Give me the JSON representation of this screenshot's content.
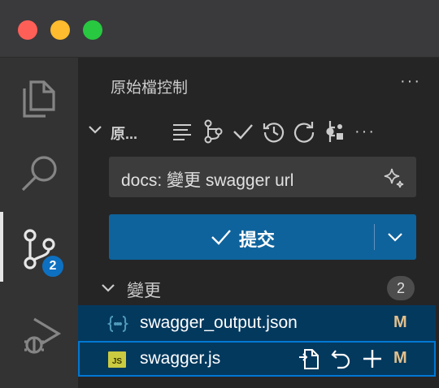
{
  "window": {
    "traffic_lights": [
      "close",
      "minimize",
      "zoom"
    ]
  },
  "activity_bar": {
    "items": [
      {
        "icon": "explorer-icon"
      },
      {
        "icon": "search-icon"
      },
      {
        "icon": "source-control-icon",
        "badge": "2",
        "active": true
      },
      {
        "icon": "run-debug-icon"
      }
    ]
  },
  "panel": {
    "title": "原始檔控制",
    "more": "···"
  },
  "repo": {
    "name": "原...",
    "actions": [
      "view-as-tree-icon",
      "branch-icon",
      "commit-check-icon",
      "history-icon",
      "refresh-icon",
      "graph-icon",
      "more-icon"
    ],
    "more": "···"
  },
  "commit": {
    "message": "docs: 變更 swagger url",
    "button_label": "提交"
  },
  "changes": {
    "label": "變更",
    "count": "2",
    "files": [
      {
        "name": "swagger_output.json",
        "status": "M",
        "icon": "json-icon"
      },
      {
        "name": "swagger.js",
        "status": "M",
        "icon": "js-icon"
      }
    ]
  },
  "colors": {
    "accent": "#0e639c",
    "badge": "#0e70c0",
    "modified": "#e2c08d",
    "selection": "#04395e"
  }
}
